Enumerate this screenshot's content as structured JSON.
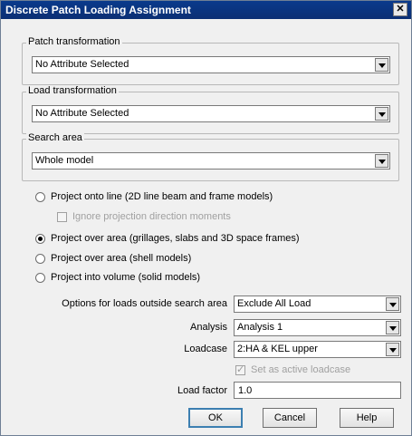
{
  "window": {
    "title": "Discrete Patch Loading Assignment",
    "close_glyph": "✕"
  },
  "groups": {
    "patch": {
      "label": "Patch transformation",
      "value": "No Attribute Selected"
    },
    "load": {
      "label": "Load transformation",
      "value": "No Attribute Selected"
    },
    "search": {
      "label": "Search area",
      "value": "Whole model"
    }
  },
  "projection": {
    "line": {
      "label": "Project onto line (2D line beam and frame models)",
      "selected": false
    },
    "ignore_moments": {
      "label": "Ignore projection direction moments",
      "checked": false,
      "enabled": false
    },
    "area_grillage": {
      "label": "Project over area (grillages, slabs and 3D space frames)",
      "selected": true
    },
    "area_shell": {
      "label": "Project over area (shell models)",
      "selected": false
    },
    "volume": {
      "label": "Project into volume (solid models)",
      "selected": false
    }
  },
  "options": {
    "outside_label": "Options for loads outside search area",
    "outside_value": "Exclude All Load",
    "analysis_label": "Analysis",
    "analysis_value": "Analysis 1",
    "loadcase_label": "Loadcase",
    "loadcase_value": "2:HA & KEL upper",
    "active_loadcase_label": "Set as active loadcase",
    "active_loadcase_checked": true,
    "load_factor_label": "Load factor",
    "load_factor_value": "1.0"
  },
  "buttons": {
    "ok": "OK",
    "cancel": "Cancel",
    "help": "Help"
  }
}
